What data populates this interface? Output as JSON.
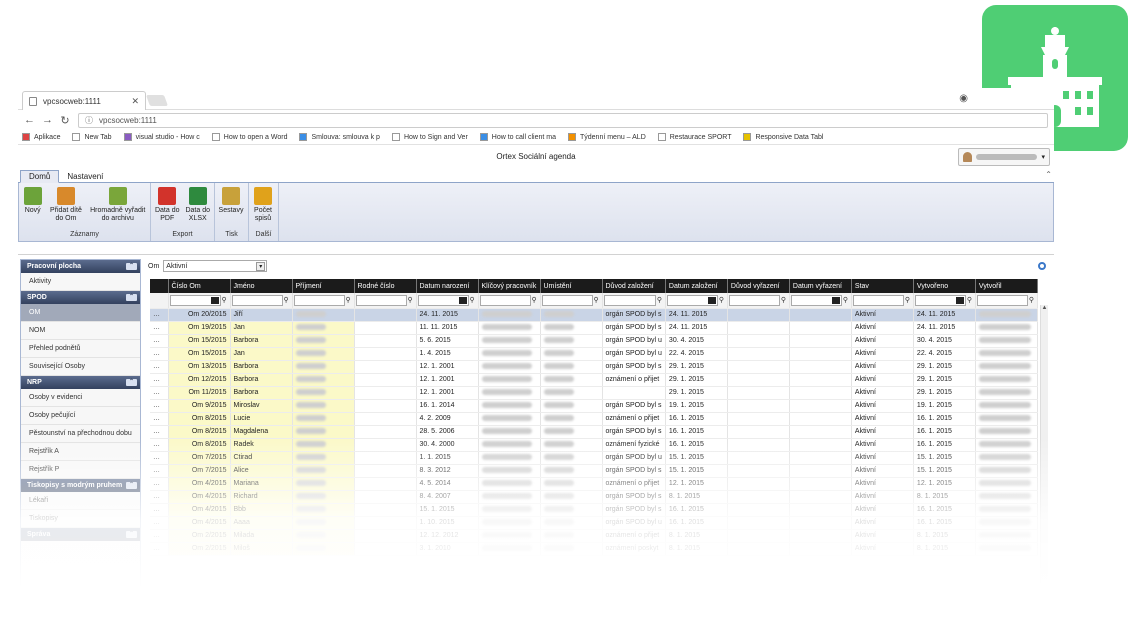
{
  "browser": {
    "tab_title": "vpcsocweb:1111",
    "address": "vpcsocweb:1111",
    "bookmarks": [
      {
        "label": "Aplikace",
        "icon": "apps-grid-icon"
      },
      {
        "label": "New Tab",
        "icon": "page-icon"
      },
      {
        "label": "visual studio - How c",
        "icon": "vs-icon"
      },
      {
        "label": "How to open a Word",
        "icon": "page-icon"
      },
      {
        "label": "Smlouva: smlouva k p",
        "icon": "windows-icon"
      },
      {
        "label": "How to Sign and Ver",
        "icon": "page-icon"
      },
      {
        "label": "How to call client ma",
        "icon": "windows-icon"
      },
      {
        "label": "Týdenní menu – ALD",
        "icon": "aldi-icon"
      },
      {
        "label": "Restaurace SPORT",
        "icon": "page-icon"
      },
      {
        "label": "Responsive Data Tabl",
        "icon": "star-icon"
      }
    ]
  },
  "app": {
    "title": "Ortex Sociální agenda"
  },
  "ribbon": {
    "tabs": [
      "Domů",
      "Nastavení"
    ],
    "groups": [
      {
        "label": "Záznamy",
        "buttons": [
          "Nový",
          "Přidat dítě do Om",
          "Hromadně vyřadit do archivu"
        ]
      },
      {
        "label": "Export",
        "buttons": [
          "Data do PDF",
          "Data do XLSX"
        ]
      },
      {
        "label": "Tisk",
        "buttons": [
          "Sestavy"
        ]
      },
      {
        "label": "Další",
        "buttons": [
          "Počet spisů"
        ]
      }
    ],
    "colors": {
      "pdf": "#d2332b",
      "xlsx": "#2e8a3e",
      "new": "#6ca33a",
      "person": "#d8892b",
      "archive": "#7aa63a",
      "print": "#c8a13a",
      "sum": "#e0a21b"
    }
  },
  "sidebar": {
    "sections": [
      {
        "title": "Pracovní plocha",
        "items": [
          "Aktivity"
        ]
      },
      {
        "title": "SPOD",
        "items": [
          "OM",
          "NOM",
          "Přehled podnětů",
          "Související Osoby"
        ]
      },
      {
        "title": "NRP",
        "items": [
          "Osoby v evidenci",
          "Osoby pečující",
          "Pěstounství na přechodnou dobu",
          "Rejstřík A",
          "Rejstřík P"
        ]
      },
      {
        "title": "Tiskopisy s modrým pruhem",
        "items": [
          "Lékaři",
          "Tiskopisy"
        ]
      },
      {
        "title": "Správa",
        "items": []
      }
    ],
    "active_item": "OM"
  },
  "filter": {
    "label": "Om",
    "value": "Aktivní"
  },
  "grid": {
    "columns": [
      "",
      "Číslo Om",
      "Jméno",
      "Příjmení",
      "Rodné číslo",
      "Datum narození",
      "Klíčový pracovník",
      "Umístění",
      "Důvod založení",
      "Datum založení",
      "Důvod vyřazení",
      "Datum vyřazení",
      "Stav",
      "Vytvořeno",
      "Vytvořil"
    ],
    "rows": [
      {
        "om": "Om 20/2015",
        "jm": "Jiří",
        "dn": "24. 11. 2015",
        "duv": "orgán SPOD byl s",
        "dz": "24. 11. 2015",
        "stav": "Aktivní",
        "vyt": "24. 11. 2015"
      },
      {
        "om": "Om 19/2015",
        "jm": "Jan",
        "dn": "11. 11. 2015",
        "duv": "orgán SPOD byl s",
        "dz": "24. 11. 2015",
        "stav": "Aktivní",
        "vyt": "24. 11. 2015"
      },
      {
        "om": "Om 15/2015",
        "jm": "Barbora",
        "dn": "5. 6. 2015",
        "duv": "orgán SPOD byl u",
        "dz": "30. 4. 2015",
        "stav": "Aktivní",
        "vyt": "30. 4. 2015"
      },
      {
        "om": "Om 15/2015",
        "jm": "Jan",
        "dn": "1. 4. 2015",
        "duv": "orgán SPOD byl u",
        "dz": "22. 4. 2015",
        "stav": "Aktivní",
        "vyt": "22. 4. 2015"
      },
      {
        "om": "Om 13/2015",
        "jm": "Barbora",
        "dn": "12. 1. 2001",
        "duv": "orgán SPOD byl s",
        "dz": "29. 1. 2015",
        "stav": "Aktivní",
        "vyt": "29. 1. 2015"
      },
      {
        "om": "Om 12/2015",
        "jm": "Barbora",
        "dn": "12. 1. 2001",
        "duv": "oznámení o přijet",
        "dz": "29. 1. 2015",
        "stav": "Aktivní",
        "vyt": "29. 1. 2015"
      },
      {
        "om": "Om 11/2015",
        "jm": "Barbora",
        "dn": "12. 1. 2001",
        "duv": "",
        "dz": "29. 1. 2015",
        "stav": "Aktivní",
        "vyt": "29. 1. 2015"
      },
      {
        "om": "Om 9/2015",
        "jm": "Miroslav",
        "dn": "16. 1. 2014",
        "duv": "orgán SPOD byl s",
        "dz": "19. 1. 2015",
        "stav": "Aktivní",
        "vyt": "19. 1. 2015"
      },
      {
        "om": "Om 8/2015",
        "jm": "Lucie",
        "dn": "4. 2. 2009",
        "duv": "oznámení o přijet",
        "dz": "16. 1. 2015",
        "stav": "Aktivní",
        "vyt": "16. 1. 2015"
      },
      {
        "om": "Om 8/2015",
        "jm": "Magdalena",
        "dn": "28. 5. 2006",
        "duv": "orgán SPOD byl s",
        "dz": "16. 1. 2015",
        "stav": "Aktivní",
        "vyt": "16. 1. 2015"
      },
      {
        "om": "Om 8/2015",
        "jm": "Radek",
        "dn": "30. 4. 2000",
        "duv": "oznámení fyzické",
        "dz": "16. 1. 2015",
        "stav": "Aktivní",
        "vyt": "16. 1. 2015"
      },
      {
        "om": "Om 7/2015",
        "jm": "Ctirad",
        "dn": "1. 1. 2015",
        "duv": "orgán SPOD byl u",
        "dz": "15. 1. 2015",
        "stav": "Aktivní",
        "vyt": "15. 1. 2015"
      },
      {
        "om": "Om 7/2015",
        "jm": "Alice",
        "dn": "8. 3. 2012",
        "duv": "orgán SPOD byl s",
        "dz": "15. 1. 2015",
        "stav": "Aktivní",
        "vyt": "15. 1. 2015"
      },
      {
        "om": "Om 4/2015",
        "jm": "Mariana",
        "dn": "4. 5. 2014",
        "duv": "oznámení o přijet",
        "dz": "12. 1. 2015",
        "stav": "Aktivní",
        "vyt": "12. 1. 2015"
      },
      {
        "om": "Om 4/2015",
        "jm": "Richard",
        "dn": "8. 4. 2007",
        "duv": "orgán SPOD byl s",
        "dz": "8. 1. 2015",
        "stav": "Aktivní",
        "vyt": "8. 1. 2015"
      },
      {
        "om": "Om 4/2015",
        "jm": "Bbb",
        "dn": "15. 1. 2015",
        "duv": "orgán SPOD byl s",
        "dz": "16. 1. 2015",
        "stav": "Aktivní",
        "vyt": "16. 1. 2015"
      },
      {
        "om": "Om 4/2015",
        "jm": "Aaaa",
        "dn": "1. 10. 2015",
        "duv": "orgán SPOD byl u",
        "dz": "16. 1. 2015",
        "stav": "Aktivní",
        "vyt": "16. 1. 2015"
      },
      {
        "om": "Om 2/2015",
        "jm": "Milada",
        "dn": "12. 12. 2012",
        "duv": "oznámení o přijet",
        "dz": "8. 1. 2015",
        "stav": "Aktivní",
        "vyt": "8. 1. 2015"
      },
      {
        "om": "Om 2/2015",
        "jm": "Miloš",
        "dn": "3. 1. 2010",
        "duv": "oznámení poskyt",
        "dz": "8. 1. 2015",
        "stav": "Aktivní",
        "vyt": "8. 1. 2015"
      }
    ]
  },
  "badge": {
    "icon": "town-hall-icon",
    "color": "#4fce74"
  }
}
